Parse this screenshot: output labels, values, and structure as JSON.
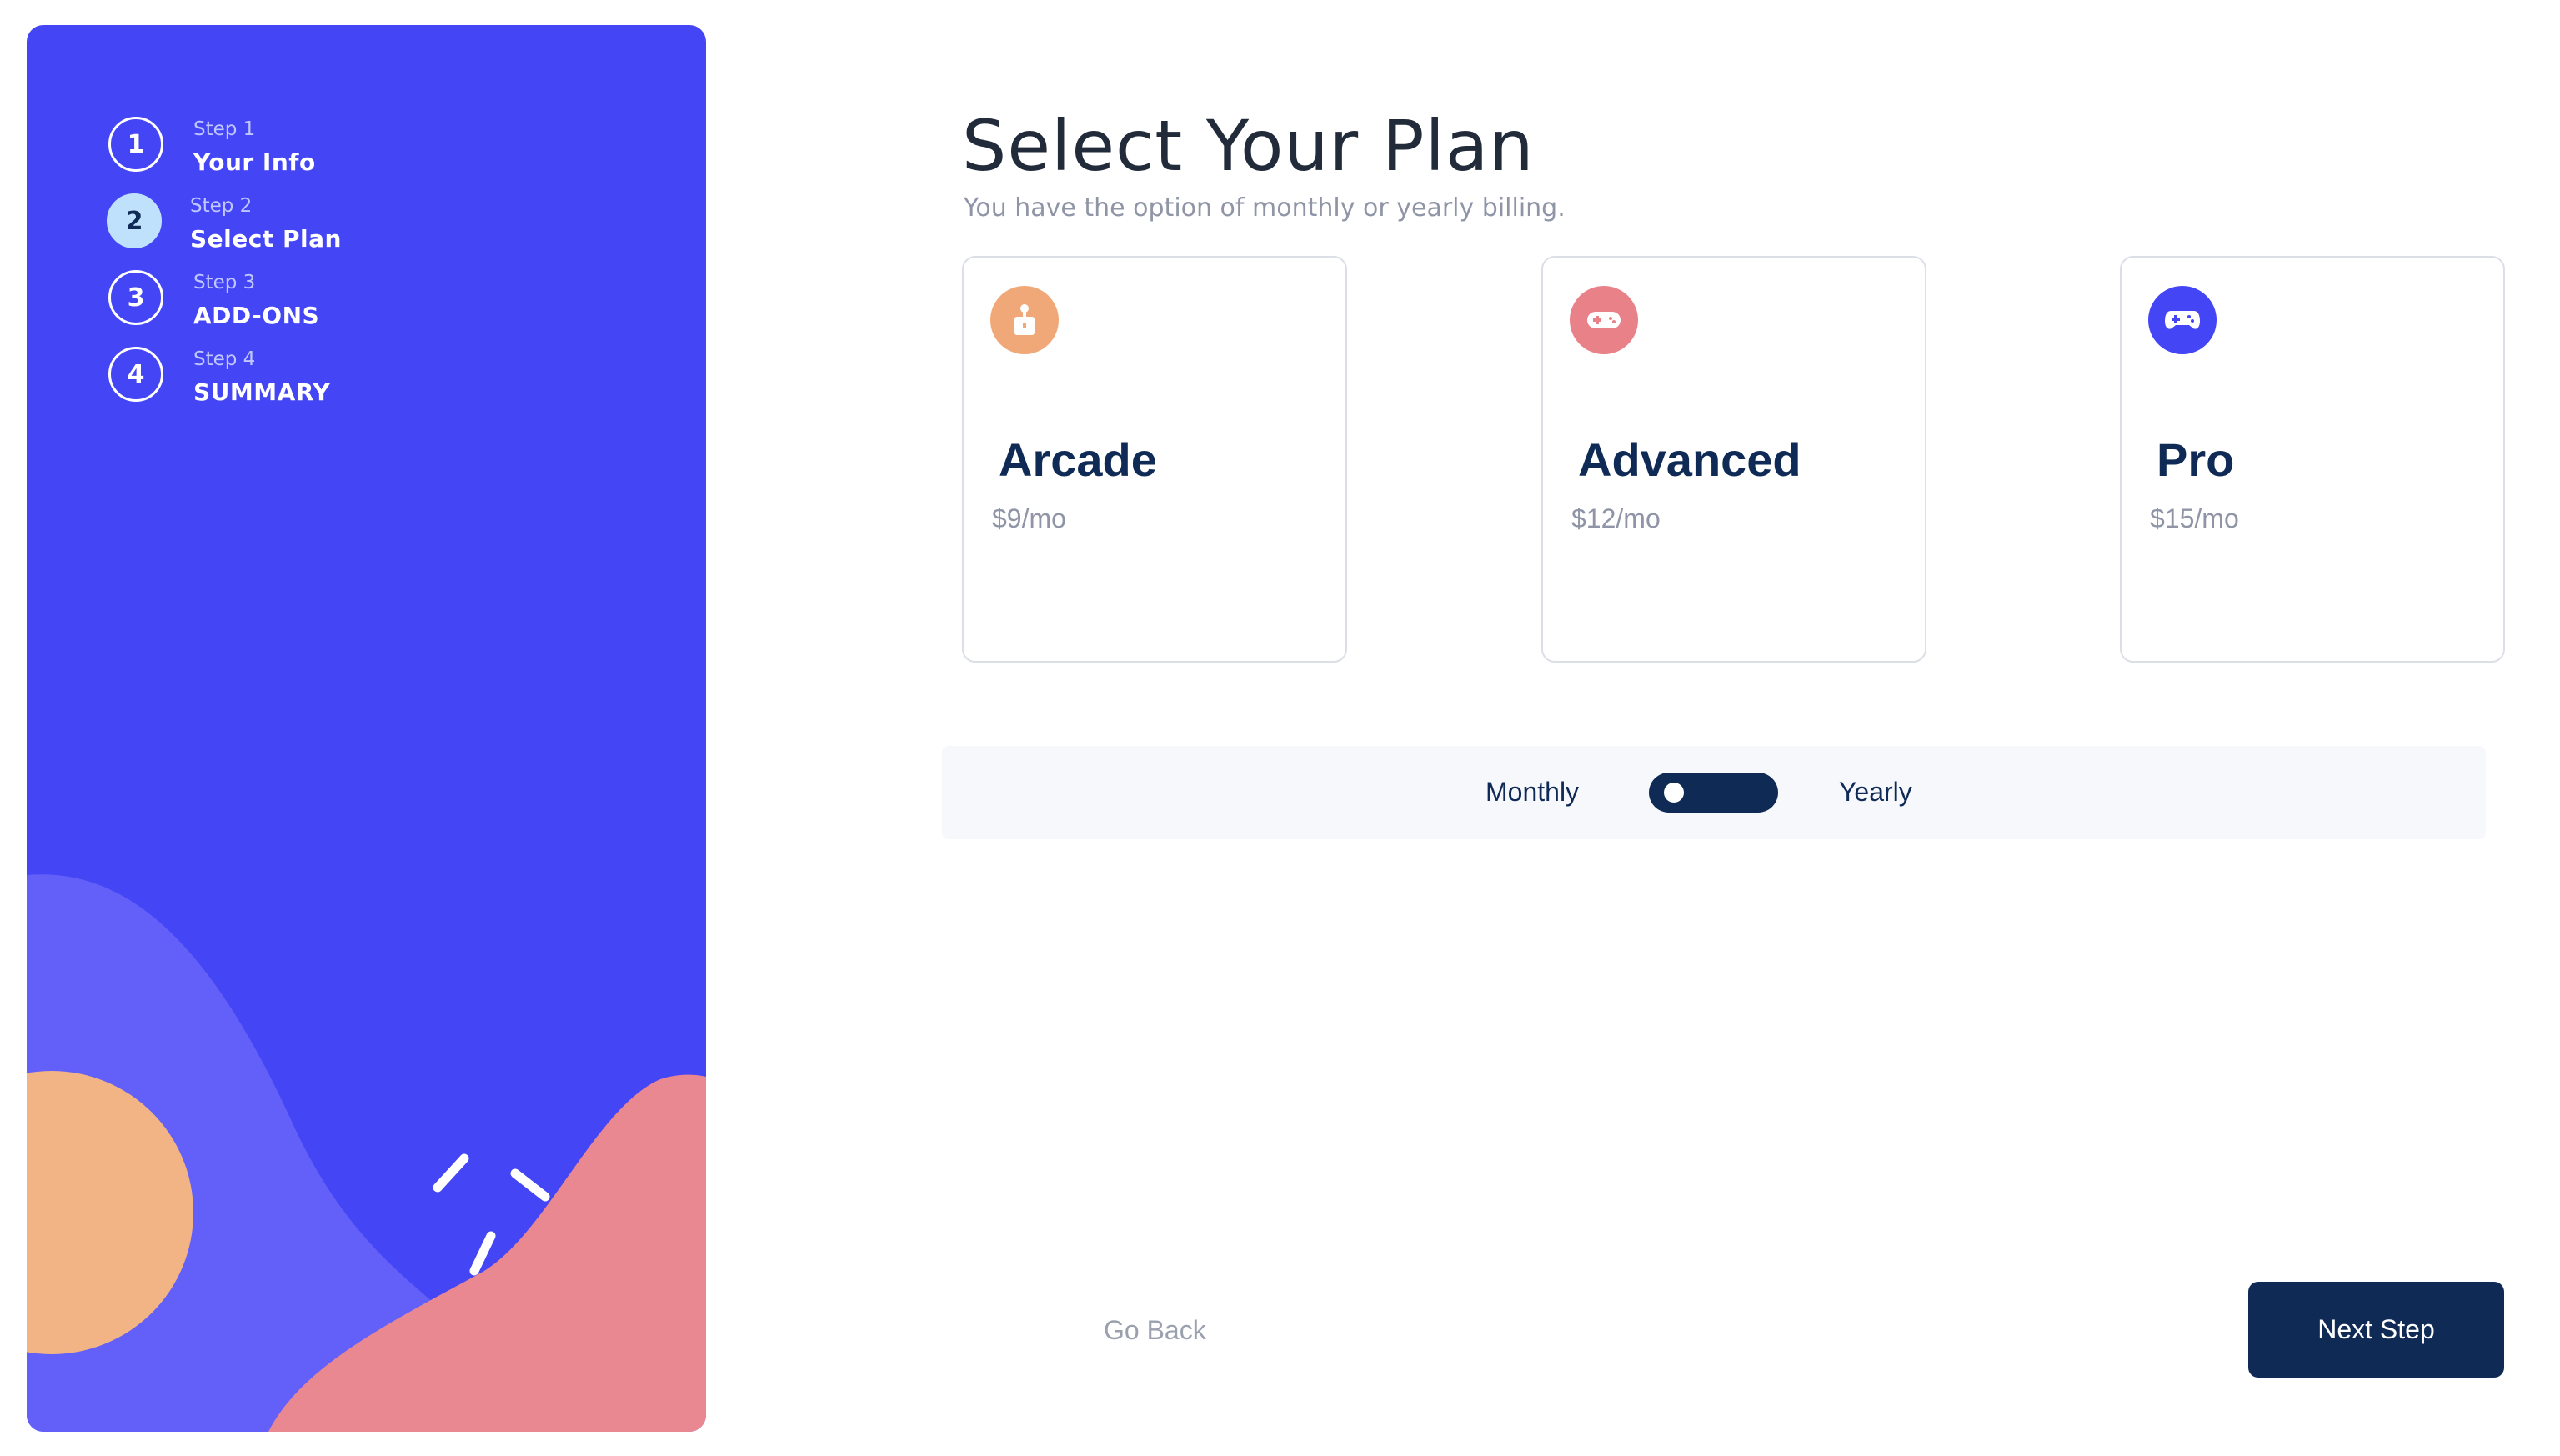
{
  "sidebar": {
    "steps": [
      {
        "number": "1",
        "kicker": "Step 1",
        "title": "Your Info"
      },
      {
        "number": "2",
        "kicker": "Step 2",
        "title": "Select Plan"
      },
      {
        "number": "3",
        "kicker": "Step 3",
        "title": "ADD-ONS"
      },
      {
        "number": "4",
        "kicker": "Step 4",
        "title": "SUMMARY"
      }
    ],
    "active_step": 2,
    "colors": {
      "background": "#4445f5",
      "active_circle": "#bfe1fb"
    }
  },
  "main": {
    "title": "Select Your Plan",
    "subtitle": "You have the option of monthly or yearly billing.",
    "plans": [
      {
        "name": "Arcade",
        "price": "$9/mo",
        "icon": "arcade-icon",
        "icon_color": "#f1a879"
      },
      {
        "name": "Advanced",
        "price": "$12/mo",
        "icon": "gamepad-icon",
        "icon_color": "#e98189"
      },
      {
        "name": "Pro",
        "price": "$15/mo",
        "icon": "controller-icon",
        "icon_color": "#4445f5"
      }
    ],
    "billing": {
      "monthly_label": "Monthly",
      "yearly_label": "Yearly",
      "selected": "Monthly"
    },
    "buttons": {
      "back": "Go Back",
      "next": "Next Step"
    }
  }
}
